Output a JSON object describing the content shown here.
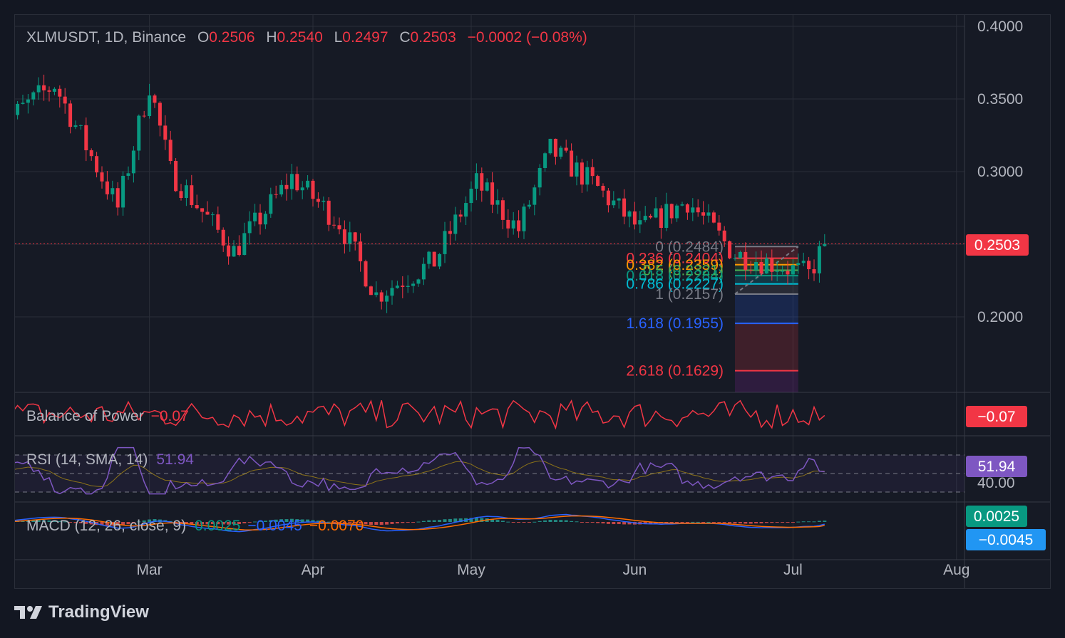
{
  "header": {
    "symbol": "XLMUSDT, 1D, Binance",
    "o_label": "O",
    "o_value": "0.2506",
    "h_label": "H",
    "h_value": "0.2540",
    "l_label": "L",
    "l_value": "0.2497",
    "c_label": "C",
    "c_value": "0.2503",
    "change": "−0.0002 (−0.08%)"
  },
  "price_axis": [
    "0.4000",
    "0.3500",
    "0.3000",
    "0.2000"
  ],
  "price_badge": "0.2503",
  "time_axis": [
    "Mar",
    "Apr",
    "May",
    "Jun",
    "Jul",
    "Aug"
  ],
  "fib": [
    {
      "label": "0 (0.2484)",
      "level": 0.2484,
      "color": "#787b86"
    },
    {
      "label": "0.236 (0.2404)",
      "level": 0.2404,
      "color": "#f23645"
    },
    {
      "label": "0.382 (0.2359)",
      "level": 0.2359,
      "color": "#ff9800"
    },
    {
      "label": "0.5 (0.2321)",
      "level": 0.2321,
      "color": "#4caf50"
    },
    {
      "label": "0.618 (0.2284)",
      "level": 0.2284,
      "color": "#089981"
    },
    {
      "label": "0.786 (0.2227)",
      "level": 0.2227,
      "color": "#00bcd4"
    },
    {
      "label": "1 (0.2157)",
      "level": 0.2157,
      "color": "#787b86"
    },
    {
      "label": "1.618 (0.1955)",
      "level": 0.1955,
      "color": "#2962ff"
    },
    {
      "label": "2.618 (0.1629)",
      "level": 0.1629,
      "color": "#f23645"
    }
  ],
  "bop": {
    "label": "Balance of Power",
    "value": "−0.07",
    "badge": "−0.07"
  },
  "rsi": {
    "label": "RSI (14, SMA, 14)",
    "value": "51.94",
    "badge": "51.94",
    "axis_label": "40.00"
  },
  "macd": {
    "label": "MACD (12, 26, close, 9)",
    "hist": "0.0025",
    "macd": "−0.0045",
    "signal": "−0.0070",
    "badge_hist": "0.0025",
    "badge_macd": "−0.0045"
  },
  "brand": "TradingView",
  "colors": {
    "up": "#089981",
    "down": "#f23645",
    "rsi": "#7e57c2",
    "bop": "#f23645",
    "macd": "#2962ff",
    "signal": "#ff6d00"
  },
  "chart_data": {
    "type": "candlestick",
    "title": "XLMUSDT, 1D, Binance",
    "ylim": [
      0.155,
      0.405
    ],
    "x_range": [
      "2024-02-01",
      "2024-08-05"
    ],
    "key_points": [
      {
        "date": "2024-02-01",
        "price": 0.33
      },
      {
        "date": "2024-02-12",
        "price": 0.36
      },
      {
        "date": "2024-02-24",
        "price": 0.275
      },
      {
        "date": "2024-03-01",
        "price": 0.36
      },
      {
        "date": "2024-03-05",
        "price": 0.3
      },
      {
        "date": "2024-03-17",
        "price": 0.245
      },
      {
        "date": "2024-03-28",
        "price": 0.296
      },
      {
        "date": "2024-04-06",
        "price": 0.265
      },
      {
        "date": "2024-04-13",
        "price": 0.215
      },
      {
        "date": "2024-04-24",
        "price": 0.238
      },
      {
        "date": "2024-05-02",
        "price": 0.292
      },
      {
        "date": "2024-05-10",
        "price": 0.26
      },
      {
        "date": "2024-05-16",
        "price": 0.315
      },
      {
        "date": "2024-05-24",
        "price": 0.292
      },
      {
        "date": "2024-06-02",
        "price": 0.26
      },
      {
        "date": "2024-06-11",
        "price": 0.28
      },
      {
        "date": "2024-06-20",
        "price": 0.243
      },
      {
        "date": "2024-06-28",
        "price": 0.236
      },
      {
        "date": "2024-07-04",
        "price": 0.229
      },
      {
        "date": "2024-07-07",
        "price": 0.25
      }
    ],
    "last_close": 0.2503,
    "rsi_last": 51.94,
    "bop_last": -0.07,
    "macd_last": {
      "hist": 0.0025,
      "macd": -0.0045,
      "signal": -0.007
    }
  }
}
